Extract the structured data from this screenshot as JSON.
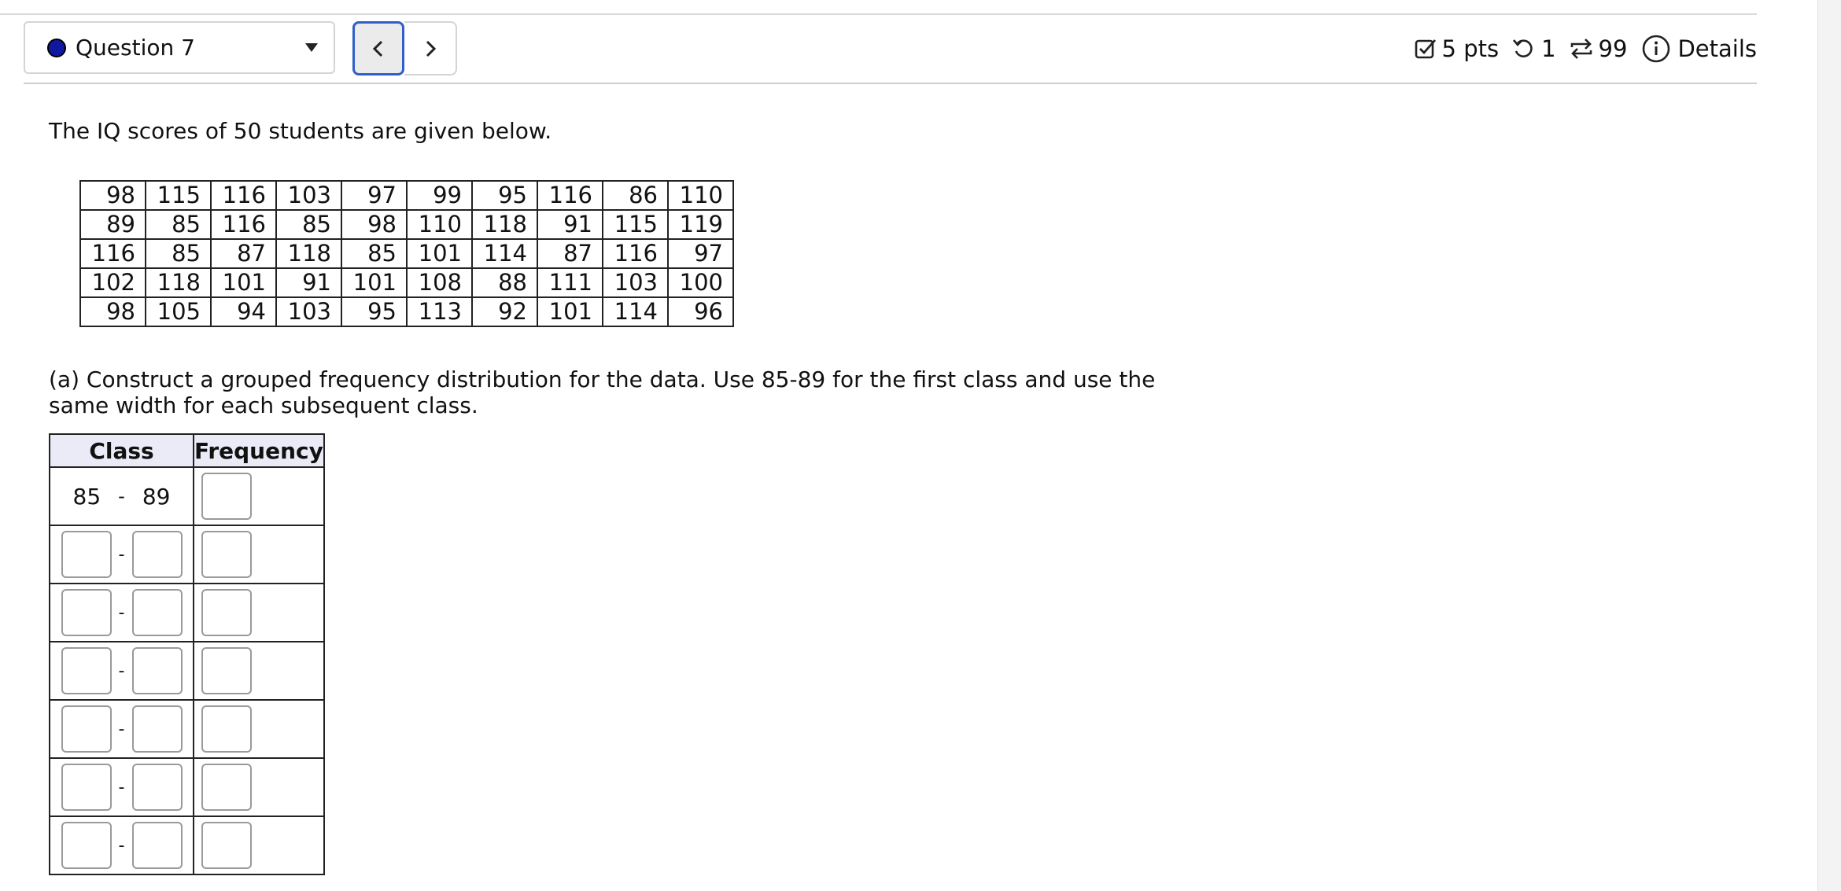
{
  "header": {
    "question_label": "Question 7",
    "points": "5 pts",
    "attempts": "1",
    "retries": "99",
    "details_label": "Details",
    "accent_color": "#1118a0"
  },
  "problem": {
    "prompt": "The IQ scores of 50 students are given below.",
    "scores": [
      [
        "98",
        "115",
        "116",
        "103",
        "97",
        "99",
        "95",
        "116",
        "86",
        "110"
      ],
      [
        "89",
        "85",
        "116",
        "85",
        "98",
        "110",
        "118",
        "91",
        "115",
        "119"
      ],
      [
        "116",
        "85",
        "87",
        "118",
        "85",
        "101",
        "114",
        "87",
        "116",
        "97"
      ],
      [
        "102",
        "118",
        "101",
        "91",
        "101",
        "108",
        "88",
        "111",
        "103",
        "100"
      ],
      [
        "98",
        "105",
        "94",
        "103",
        "95",
        "113",
        "92",
        "101",
        "114",
        "96"
      ]
    ],
    "part_a": "(a) Construct a grouped frequency distribution for the data. Use 85-89 for the first class and use the same width for each subsequent class."
  },
  "freq_table": {
    "col_class": "Class",
    "col_frequency": "Frequency",
    "first_class_low": "85",
    "first_class_sep": "-",
    "first_class_high": "89",
    "blank_row_sep": "-",
    "blank_rows": 6
  }
}
